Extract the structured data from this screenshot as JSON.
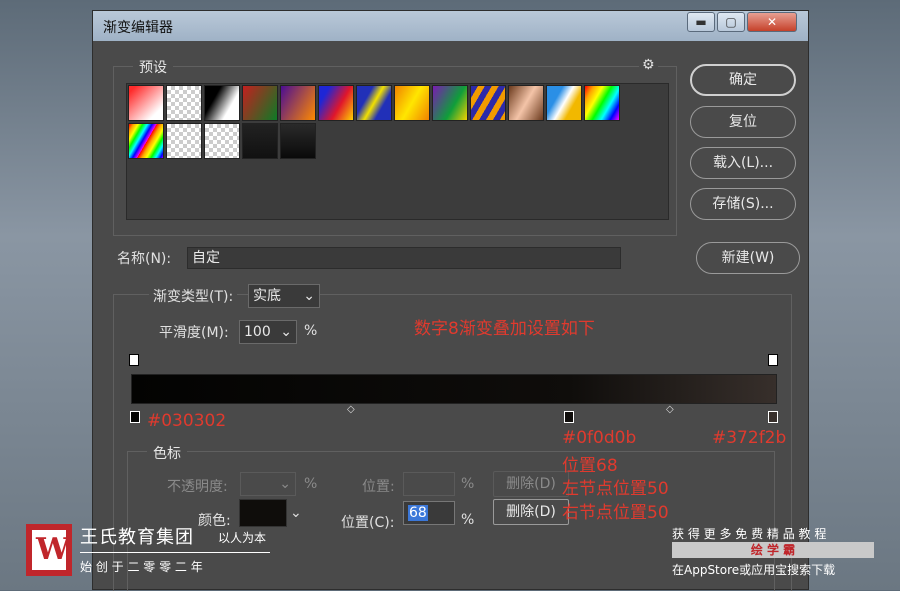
{
  "window": {
    "title": "渐变编辑器",
    "min": "▬",
    "max": "▢",
    "close": "✕"
  },
  "presets": {
    "legend": "预设",
    "gear": "⚙"
  },
  "buttons": {
    "ok": "确定",
    "reset": "复位",
    "load": "载入(L)...",
    "save": "存储(S)...",
    "new": "新建(W)"
  },
  "name": {
    "label": "名称(N):",
    "value": "自定"
  },
  "gradient_type": {
    "label": "渐变类型(T):",
    "value": "实底"
  },
  "smoothness": {
    "label": "平滑度(M):",
    "value": "100",
    "unit": "%"
  },
  "color_stops": {
    "legend": "色标",
    "opacity_label": "不透明度:",
    "opacity_unit": "%",
    "opacity_pos_label": "位置:",
    "opacity_pos_unit": "%",
    "opacity_delete": "删除(D)",
    "color_label": "颜色:",
    "color_value": "#0f0d0b",
    "color_pos_label": "位置(C):",
    "color_pos_value": "68",
    "color_pos_unit": "%",
    "color_delete": "删除(D)"
  },
  "annotations": {
    "title": "数字8渐变叠加设置如下",
    "stop_left": "#030302",
    "stop_mid": "#0f0d0b",
    "stop_right": "#372f2b",
    "pos": "位置68",
    "left_mid": "左节点位置50",
    "right_mid": "右节点位置50"
  },
  "watermark": {
    "brand": "王氏教育集团",
    "slogan": "以人为本",
    "founded": "始 创 于 二 零 零 二 年",
    "promo": "获 得 更 多 免 费 精 品 教 程",
    "app": "绘 学 霸",
    "store": "在AppStore或应用宝搜索下载"
  }
}
